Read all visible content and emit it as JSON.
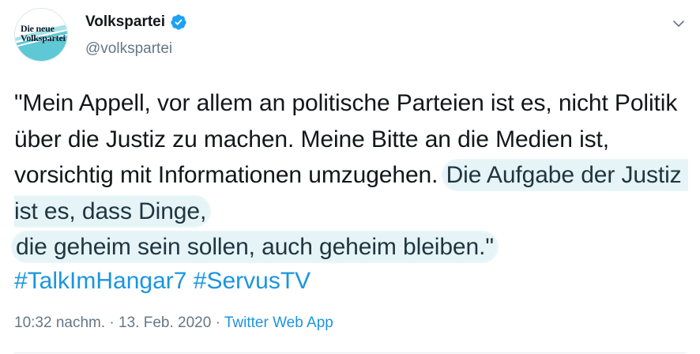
{
  "user": {
    "avatar_text_line1": "Die neue",
    "avatar_text_line2": "Volkspartei",
    "display_name": "Volkspartei",
    "handle": "@volkspartei",
    "verified": true
  },
  "tweet": {
    "text_plain": "\"Mein Appell, vor allem an politische Parteien ist es, nicht Politik über die Justiz zu machen. Meine Bitte an die Medien ist, vorsichtig mit Informationen umzugehen. ",
    "text_highlight_1": "Die Aufgabe der Justiz ist es, dass Dinge,",
    "text_highlight_2": "die geheim sein sollen, auch geheim bleiben.\"",
    "hashtags": [
      "#TalkImHangar7",
      "#ServusTV"
    ]
  },
  "meta": {
    "time": "10:32 nachm.",
    "separator": " · ",
    "date": "13. Feb. 2020",
    "source": "Twitter Web App"
  },
  "colors": {
    "link": "#1b95e0",
    "secondary": "#657786",
    "highlight": "#e6f4f7",
    "logo_teal": "#5ec8d5"
  },
  "icons": {
    "verified": "verified-badge-icon",
    "menu": "chevron-down-icon"
  }
}
